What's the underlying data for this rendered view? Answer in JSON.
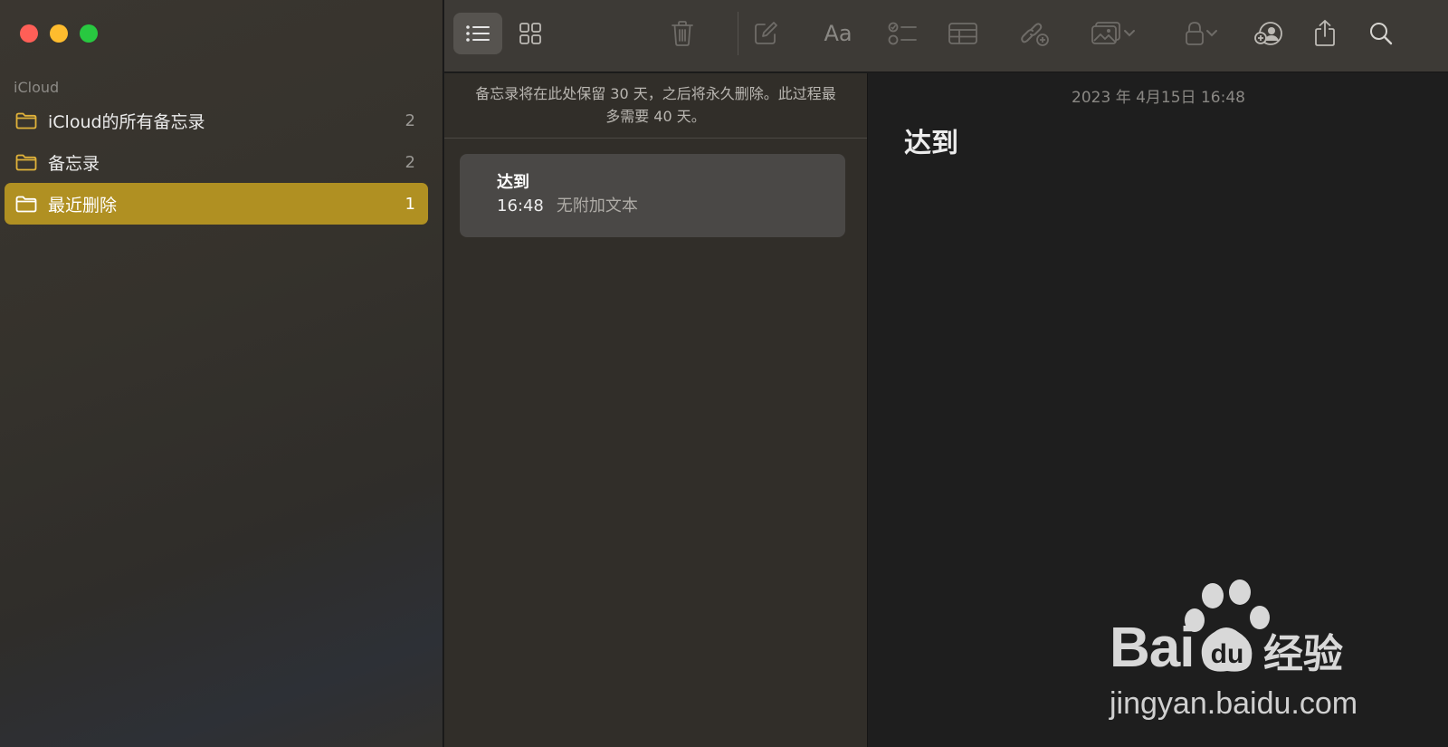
{
  "sidebar": {
    "account_label": "iCloud",
    "folders": [
      {
        "label": "iCloud的所有备忘录",
        "count": "2",
        "selected": false
      },
      {
        "label": "备忘录",
        "count": "2",
        "selected": false
      },
      {
        "label": "最近删除",
        "count": "1",
        "selected": true
      }
    ]
  },
  "toolbar": {
    "font_button_label": "Aa",
    "buttons": [
      "list-view",
      "gallery-view",
      "delete",
      "compose",
      "format",
      "checklist",
      "table",
      "collaborate",
      "media",
      "lock",
      "share-note",
      "share",
      "search"
    ]
  },
  "list": {
    "info_text": "备忘录将在此处保留 30 天，之后将永久删除。此过程最多需要 40 天。",
    "notes": [
      {
        "title": "达到",
        "time": "16:48",
        "preview": "无附加文本"
      }
    ]
  },
  "editor": {
    "date": "2023 年 4月15日 16:48",
    "title": "达到"
  },
  "watermark": {
    "brand_text": "Bai",
    "brand_cn": "经验",
    "url": "jingyan.baidu.com"
  },
  "colors": {
    "accent": "#b09022",
    "folder_icon": "#e0b23a",
    "sidebar_bg": "#36322d",
    "list_bg": "#312e29",
    "editor_bg": "#1e1e1e",
    "toolbar_bg": "#3d3a36"
  }
}
